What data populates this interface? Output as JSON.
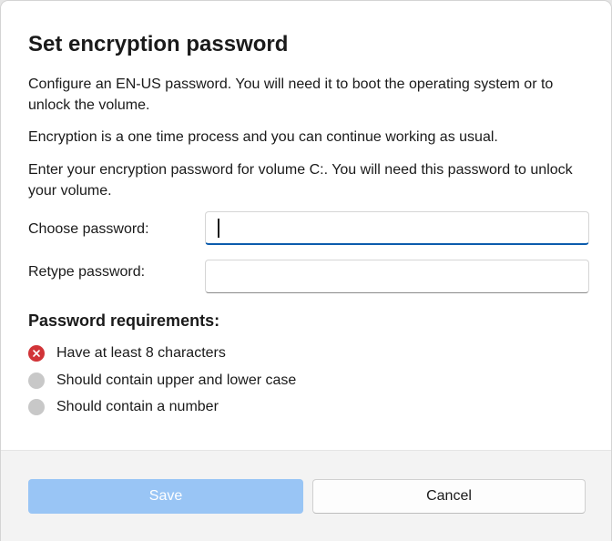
{
  "dialog": {
    "title": "Set encryption password",
    "paragraphs": [
      "Configure an EN-US password. You will need it to boot the operating system or to unlock the volume.",
      "Encryption is a one time process and you can continue working as usual.",
      "Enter your encryption password for volume C:. You will need this password to unlock your volume."
    ]
  },
  "fields": {
    "choose": {
      "label": "Choose password:",
      "value": "",
      "focused": true
    },
    "retype": {
      "label": "Retype password:",
      "value": ""
    }
  },
  "requirements": {
    "heading": "Password requirements:",
    "items": [
      {
        "label": "Have at least 8 characters",
        "status": "failed",
        "icon": "error-x-icon"
      },
      {
        "label": "Should contain upper and lower case",
        "status": "pending",
        "icon": "status-dot-icon"
      },
      {
        "label": "Should contain a number",
        "status": "pending",
        "icon": "status-dot-icon"
      }
    ]
  },
  "buttons": {
    "save": "Save",
    "save_enabled": false,
    "cancel": "Cancel"
  },
  "colors": {
    "accent": "#0b5cad",
    "save_disabled": "#99c5f5",
    "error": "#d13438",
    "pending": "#c8c8c8",
    "footer": "#f3f3f3"
  }
}
